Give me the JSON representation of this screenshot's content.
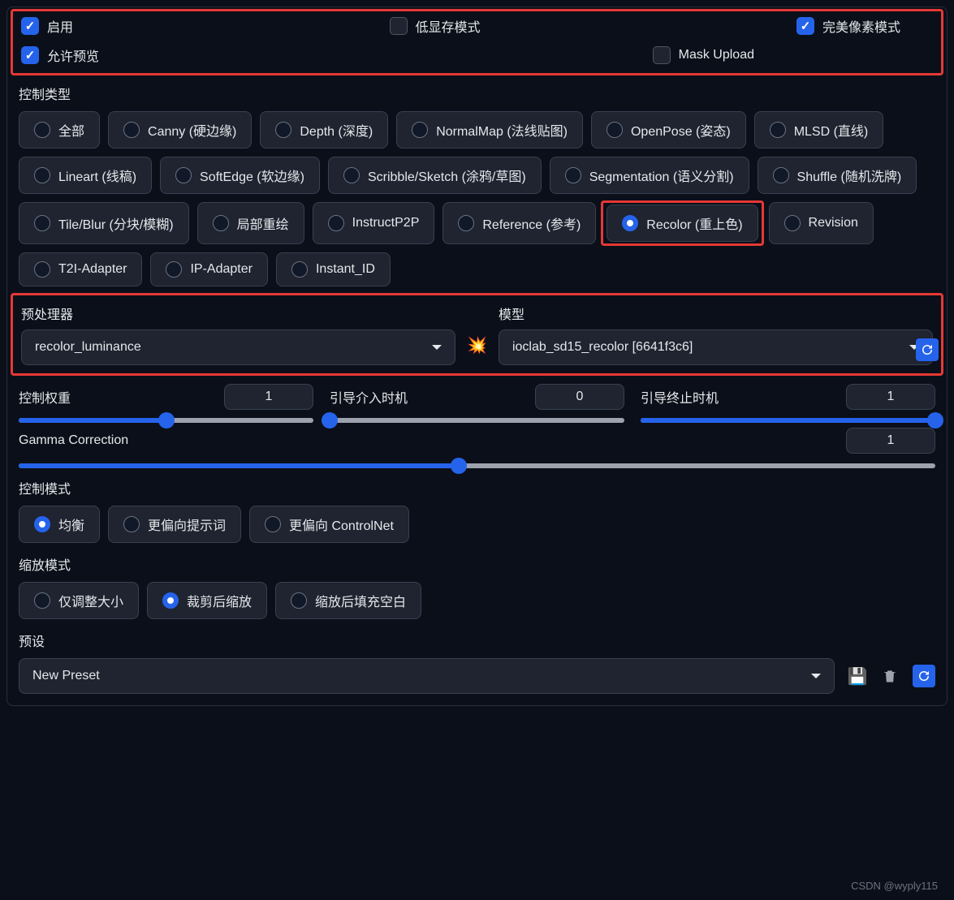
{
  "checkboxes": {
    "enable": {
      "label": "启用",
      "checked": true
    },
    "low_vram": {
      "label": "低显存模式",
      "checked": false
    },
    "perfect_pixel": {
      "label": "完美像素模式",
      "checked": true
    },
    "allow_preview": {
      "label": "允许预览",
      "checked": true
    },
    "mask_upload": {
      "label": "Mask Upload",
      "checked": false
    }
  },
  "control_type": {
    "label": "控制类型",
    "selected": "Recolor (重上色)",
    "options": [
      "全部",
      "Canny (硬边缘)",
      "Depth (深度)",
      "NormalMap (法线贴图)",
      "OpenPose (姿态)",
      "MLSD (直线)",
      "Lineart (线稿)",
      "SoftEdge (软边缘)",
      "Scribble/Sketch (涂鸦/草图)",
      "Segmentation (语义分割)",
      "Shuffle (随机洗牌)",
      "Tile/Blur (分块/模糊)",
      "局部重绘",
      "InstructP2P",
      "Reference (参考)",
      "Recolor (重上色)",
      "Revision",
      "T2I-Adapter",
      "IP-Adapter",
      "Instant_ID"
    ]
  },
  "preprocessor": {
    "label": "预处理器",
    "value": "recolor_luminance"
  },
  "model": {
    "label": "模型",
    "value": "ioclab_sd15_recolor [6641f3c6]"
  },
  "sliders": {
    "weight": {
      "label": "控制权重",
      "value": "1",
      "fill_pct": 50
    },
    "guidance_start": {
      "label": "引导介入时机",
      "value": "0",
      "fill_pct": 0
    },
    "guidance_end": {
      "label": "引导终止时机",
      "value": "1",
      "fill_pct": 100
    },
    "gamma": {
      "label": "Gamma Correction",
      "value": "1",
      "fill_pct": 48
    }
  },
  "control_mode": {
    "label": "控制模式",
    "selected": "均衡",
    "options": [
      "均衡",
      "更偏向提示词",
      "更偏向 ControlNet"
    ]
  },
  "resize_mode": {
    "label": "缩放模式",
    "selected": "裁剪后缩放",
    "options": [
      "仅调整大小",
      "裁剪后缩放",
      "缩放后填充空白"
    ]
  },
  "preset": {
    "label": "预设",
    "value": "New Preset"
  },
  "watermark": "CSDN @wyply115"
}
